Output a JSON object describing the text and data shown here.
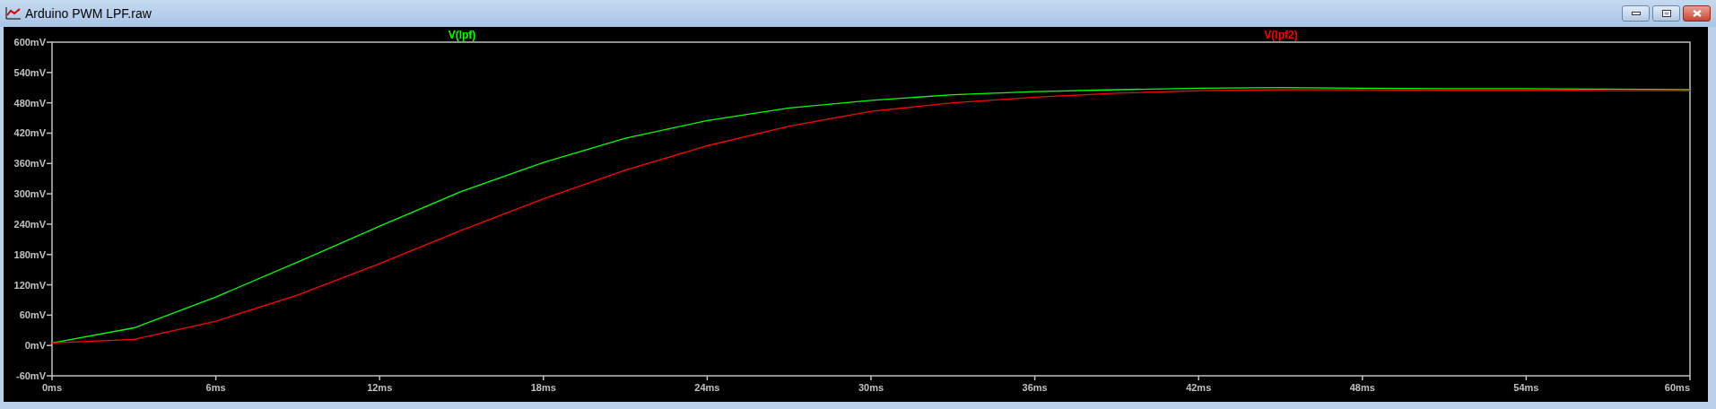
{
  "window": {
    "title": "Arduino PWM LPF.raw"
  },
  "plot": {
    "chart_data": {
      "type": "line",
      "x": [
        0,
        3,
        6,
        9,
        12,
        15,
        18,
        21,
        24,
        27,
        30,
        33,
        36,
        39,
        42,
        45,
        48,
        51,
        54,
        57,
        60
      ],
      "series": [
        {
          "name": "V(lpf)",
          "color": "#00ff00",
          "values": [
            5,
            35,
            96,
            165,
            236,
            305,
            362,
            410,
            445,
            470,
            485,
            496,
            502,
            506,
            509,
            510,
            509,
            508,
            508,
            507,
            506
          ]
        },
        {
          "name": "V(lpf2)",
          "color": "#ff0000",
          "values": [
            5,
            12,
            48,
            100,
            162,
            228,
            290,
            347,
            395,
            434,
            463,
            480,
            491,
            499,
            504,
            506,
            506,
            505,
            505,
            504,
            504
          ]
        }
      ],
      "xlim": [
        0,
        60
      ],
      "ylim": [
        -60,
        600
      ],
      "xticks": [
        {
          "value": 0,
          "label": "0ms"
        },
        {
          "value": 6,
          "label": "6ms"
        },
        {
          "value": 12,
          "label": "12ms"
        },
        {
          "value": 18,
          "label": "18ms"
        },
        {
          "value": 24,
          "label": "24ms"
        },
        {
          "value": 30,
          "label": "30ms"
        },
        {
          "value": 36,
          "label": "36ms"
        },
        {
          "value": 42,
          "label": "42ms"
        },
        {
          "value": 48,
          "label": "48ms"
        },
        {
          "value": 54,
          "label": "54ms"
        },
        {
          "value": 60,
          "label": "60ms"
        }
      ],
      "yticks": [
        {
          "value": 600,
          "label": "600mV"
        },
        {
          "value": 540,
          "label": "540mV"
        },
        {
          "value": 480,
          "label": "480mV"
        },
        {
          "value": 420,
          "label": "420mV"
        },
        {
          "value": 360,
          "label": "360mV"
        },
        {
          "value": 300,
          "label": "300mV"
        },
        {
          "value": 240,
          "label": "240mV"
        },
        {
          "value": 180,
          "label": "180mV"
        },
        {
          "value": 120,
          "label": "120mV"
        },
        {
          "value": 60,
          "label": "60mV"
        },
        {
          "value": 0,
          "label": "0mV"
        },
        {
          "value": -60,
          "label": "-60mV"
        }
      ]
    }
  }
}
